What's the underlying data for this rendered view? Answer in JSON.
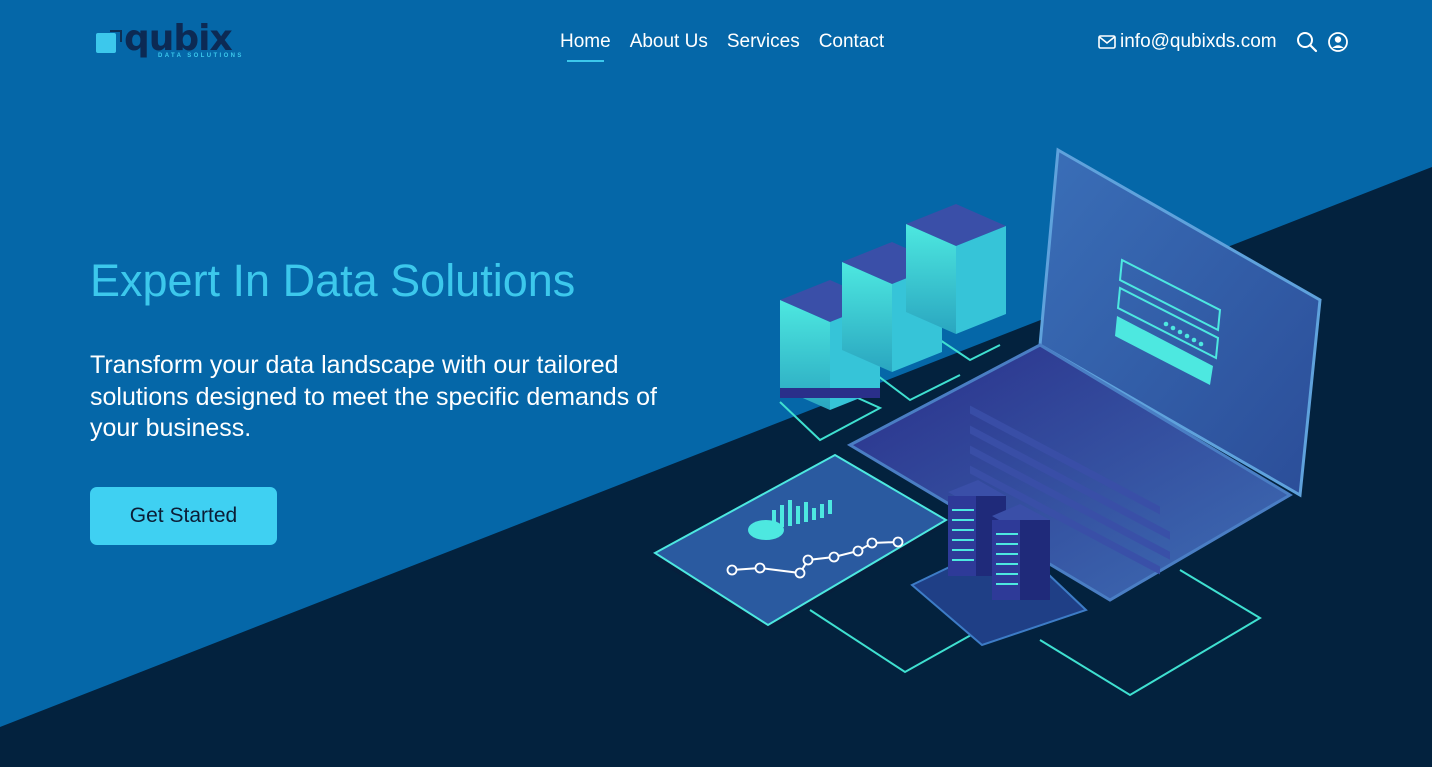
{
  "brand": {
    "name": "qubix",
    "tagline": "DATA SOLUTIONS"
  },
  "nav": {
    "items": [
      {
        "label": "Home",
        "active": true
      },
      {
        "label": "About Us",
        "active": false
      },
      {
        "label": "Services",
        "active": false
      },
      {
        "label": "Contact",
        "active": false
      }
    ]
  },
  "header": {
    "email": "info@qubixds.com",
    "icons": [
      "mail-icon",
      "search-icon",
      "user-icon"
    ]
  },
  "hero": {
    "title": "Expert In Data Solutions",
    "subtitle": "Transform your data landscape with our tailored solutions designed to meet the specific demands of your business.",
    "cta_label": "Get Started"
  },
  "colors": {
    "primary_bg": "#0567a8",
    "dark_bg": "#03223e",
    "accent": "#3cc8ec",
    "logo_text": "#0c2a54"
  }
}
